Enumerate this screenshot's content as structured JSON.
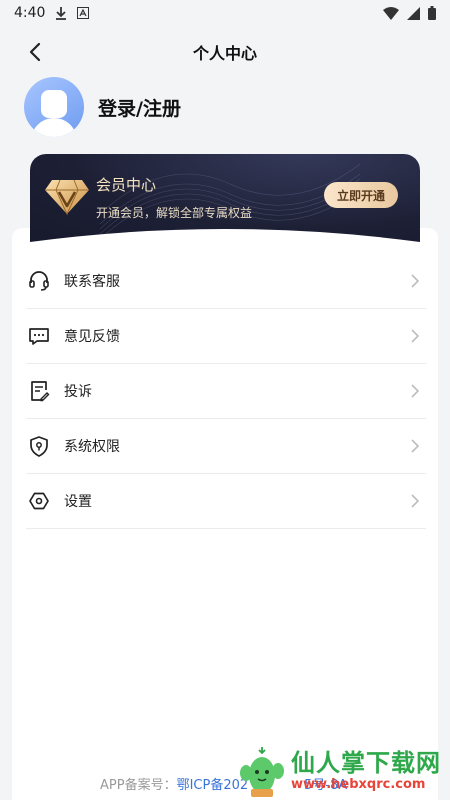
{
  "status_bar": {
    "time": "4:40"
  },
  "nav": {
    "title": "个人中心"
  },
  "profile": {
    "login_label": "登录/注册"
  },
  "vip": {
    "title": "会员中心",
    "subtitle": "开通会员，解锁全部专属权益",
    "button": "立即开通"
  },
  "menu": {
    "items": [
      {
        "label": "联系客服",
        "icon": "headset-icon"
      },
      {
        "label": "意见反馈",
        "icon": "feedback-icon"
      },
      {
        "label": "投诉",
        "icon": "complaint-icon"
      },
      {
        "label": "系统权限",
        "icon": "shield-icon"
      },
      {
        "label": "设置",
        "icon": "settings-icon"
      }
    ]
  },
  "footer": {
    "icp_prefix": "APP备案号：",
    "icp_number": "鄂ICP备202",
    "icp_suffix": "5号-8A"
  },
  "watermark": {
    "title": "仙人掌下载网",
    "url": "www.hebxqrc.com"
  },
  "colors": {
    "background": "#f3f4f6",
    "vip_card": "#1d2035",
    "vip_gold": "#e8c89f",
    "link": "#3a74d9"
  }
}
